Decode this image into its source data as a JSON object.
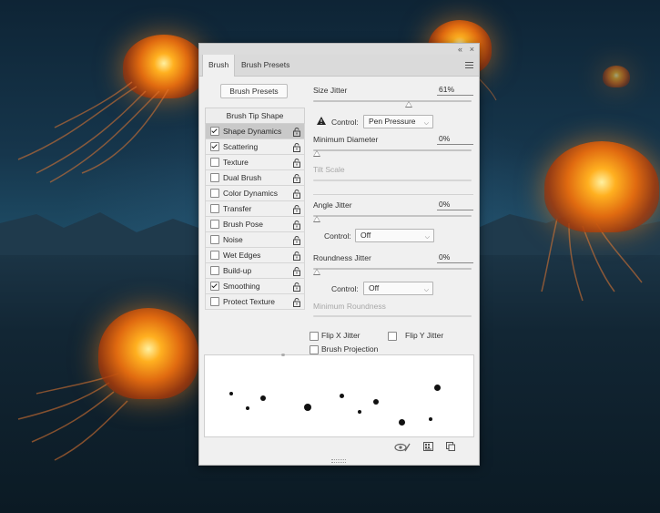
{
  "panel": {
    "titlebar": {
      "collapse_glyph": "«",
      "close_glyph": "×"
    },
    "tabs": [
      {
        "label": "Brush",
        "active": true
      },
      {
        "label": "Brush Presets",
        "active": false
      }
    ],
    "menu_icon": "panel-menu-icon",
    "brush_presets_button": "Brush Presets",
    "tip_header": "Brush Tip Shape",
    "options": [
      {
        "label": "Shape Dynamics",
        "checked": true,
        "selected": true
      },
      {
        "label": "Scattering",
        "checked": true,
        "selected": false
      },
      {
        "label": "Texture",
        "checked": false,
        "selected": false
      },
      {
        "label": "Dual Brush",
        "checked": false,
        "selected": false
      },
      {
        "label": "Color Dynamics",
        "checked": false,
        "selected": false
      },
      {
        "label": "Transfer",
        "checked": false,
        "selected": false
      },
      {
        "label": "Brush Pose",
        "checked": false,
        "selected": false
      },
      {
        "label": "Noise",
        "checked": false,
        "selected": false
      },
      {
        "label": "Wet Edges",
        "checked": false,
        "selected": false
      },
      {
        "label": "Build-up",
        "checked": false,
        "selected": false
      },
      {
        "label": "Smoothing",
        "checked": true,
        "selected": false
      },
      {
        "label": "Protect Texture",
        "checked": false,
        "selected": false
      }
    ],
    "settings": {
      "size_jitter": {
        "label": "Size Jitter",
        "value": "61%",
        "level": 0.61
      },
      "size_control": {
        "label": "Control:",
        "value": "Pen Pressure"
      },
      "minimum_diameter": {
        "label": "Minimum Diameter",
        "value": "0%",
        "level": 0
      },
      "tilt_scale": {
        "label": "Tilt Scale"
      },
      "angle_jitter": {
        "label": "Angle Jitter",
        "value": "0%",
        "level": 0
      },
      "angle_control": {
        "label": "Control:",
        "value": "Off"
      },
      "roundness_jitter": {
        "label": "Roundness Jitter",
        "value": "0%",
        "level": 0
      },
      "roundness_control": {
        "label": "Control:",
        "value": "Off"
      },
      "minimum_roundness": {
        "label": "Minimum Roundness"
      },
      "flip_x": {
        "label": "Flip X Jitter",
        "checked": false
      },
      "flip_y": {
        "label": "Flip Y Jitter",
        "checked": false
      },
      "brush_projection": {
        "label": "Brush Projection",
        "checked": false
      }
    },
    "bottom_icons": [
      "eye-brush-icon",
      "grid-icon",
      "new-preset-icon"
    ]
  },
  "colors": {
    "panel_bg": "#f0f0f0",
    "selected_row": "#c9c9c9",
    "jelly_glow": "#ff9a20"
  }
}
